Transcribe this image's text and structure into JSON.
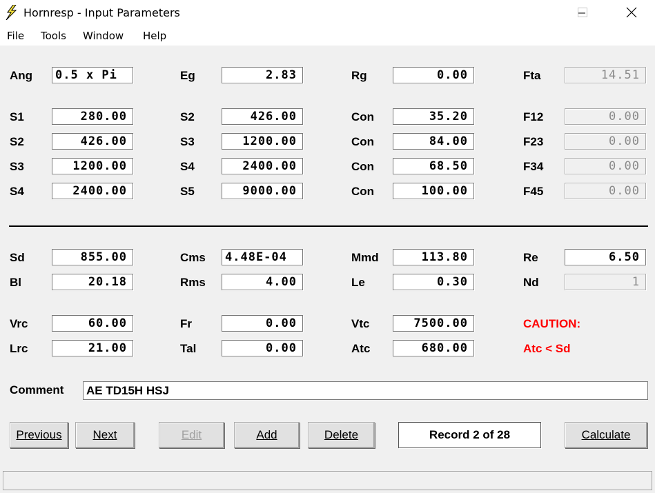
{
  "window": {
    "title": "Hornresp - Input Parameters",
    "icon": "lightning-bolt-icon",
    "controls": [
      "minimize-icon",
      "maximize-icon",
      "close-icon"
    ]
  },
  "menu": [
    "File",
    "Tools",
    "Window",
    "Help"
  ],
  "top_section": {
    "row0": [
      {
        "label": "Ang",
        "value": "0.5 x Pi"
      },
      {
        "label": "Eg",
        "value": "2.83"
      },
      {
        "label": "Rg",
        "value": "0.00"
      },
      {
        "label": "Fta",
        "value": "14.51"
      }
    ],
    "rows": [
      [
        {
          "label": "S1",
          "value": "280.00"
        },
        {
          "label": "S2",
          "value": "426.00"
        },
        {
          "label": "Con",
          "value": "35.20"
        },
        {
          "label": "F12",
          "value": "0.00"
        }
      ],
      [
        {
          "label": "S2",
          "value": "426.00"
        },
        {
          "label": "S3",
          "value": "1200.00"
        },
        {
          "label": "Con",
          "value": "84.00"
        },
        {
          "label": "F23",
          "value": "0.00"
        }
      ],
      [
        {
          "label": "S3",
          "value": "1200.00"
        },
        {
          "label": "S4",
          "value": "2400.00"
        },
        {
          "label": "Con",
          "value": "68.50"
        },
        {
          "label": "F34",
          "value": "0.00"
        }
      ],
      [
        {
          "label": "S4",
          "value": "2400.00"
        },
        {
          "label": "S5",
          "value": "9000.00"
        },
        {
          "label": "Con",
          "value": "100.00"
        },
        {
          "label": "F45",
          "value": "0.00"
        }
      ]
    ]
  },
  "driver_section": {
    "row1": [
      {
        "label": "Sd",
        "value": "855.00"
      },
      {
        "label": "Cms",
        "value": "4.48E-04"
      },
      {
        "label": "Mmd",
        "value": "113.80"
      },
      {
        "label": "Re",
        "value": "6.50"
      }
    ],
    "row2": [
      {
        "label": "Bl",
        "value": "20.18"
      },
      {
        "label": "Rms",
        "value": "4.00"
      },
      {
        "label": "Le",
        "value": "0.30"
      },
      {
        "label": "Nd",
        "value": "1"
      }
    ],
    "row3": [
      {
        "label": "Vrc",
        "value": "60.00"
      },
      {
        "label": "Fr",
        "value": "0.00"
      },
      {
        "label": "Vtc",
        "value": "7500.00"
      }
    ],
    "row4": [
      {
        "label": "Lrc",
        "value": "21.00"
      },
      {
        "label": "Tal",
        "value": "0.00"
      },
      {
        "label": "Atc",
        "value": "680.00"
      }
    ],
    "caution": {
      "title": "CAUTION:",
      "message": "Atc < Sd",
      "color": "#ff0000"
    }
  },
  "comment": {
    "label": "Comment",
    "value": "AE TD15H HSJ"
  },
  "buttons": {
    "previous": "Previous",
    "next": "Next",
    "edit": "Edit",
    "add": "Add",
    "delete": "Delete",
    "calculate": "Calculate"
  },
  "record": "Record 2 of 28"
}
